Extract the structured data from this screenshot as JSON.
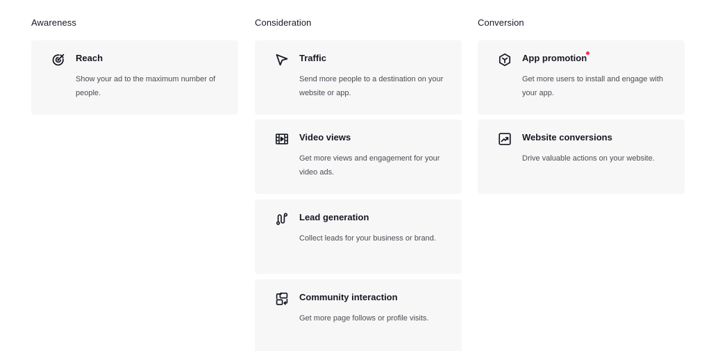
{
  "colors": {
    "card_background": "#f7f7f7",
    "text_primary": "#161823",
    "text_secondary": "#4a4c54",
    "new_indicator": "#fe2c55"
  },
  "columns": {
    "awareness": {
      "heading": "Awareness",
      "cards": [
        {
          "title": "Reach",
          "description": "Show your ad to the maximum number of people.",
          "icon": "target-icon"
        }
      ]
    },
    "consideration": {
      "heading": "Consideration",
      "cards": [
        {
          "title": "Traffic",
          "description": "Send more people to a destination on your website or app.",
          "icon": "cursor-arrow-icon"
        },
        {
          "title": "Video views",
          "description": "Get more views and engagement for your video ads.",
          "icon": "film-strip-icon"
        },
        {
          "title": "Lead generation",
          "description": "Collect leads for your business or brand.",
          "icon": "route-icon"
        },
        {
          "title": "Community interaction",
          "description": "Get more page follows or profile visits.",
          "icon": "swap-boxes-icon"
        }
      ]
    },
    "conversion": {
      "heading": "Conversion",
      "cards": [
        {
          "title": "App promotion",
          "description": "Get more users to install and engage with your app.",
          "icon": "app-cube-icon",
          "has_new_indicator": true
        },
        {
          "title": "Website conversions",
          "description": "Drive valuable actions on your website.",
          "icon": "trend-chart-icon"
        }
      ]
    }
  }
}
